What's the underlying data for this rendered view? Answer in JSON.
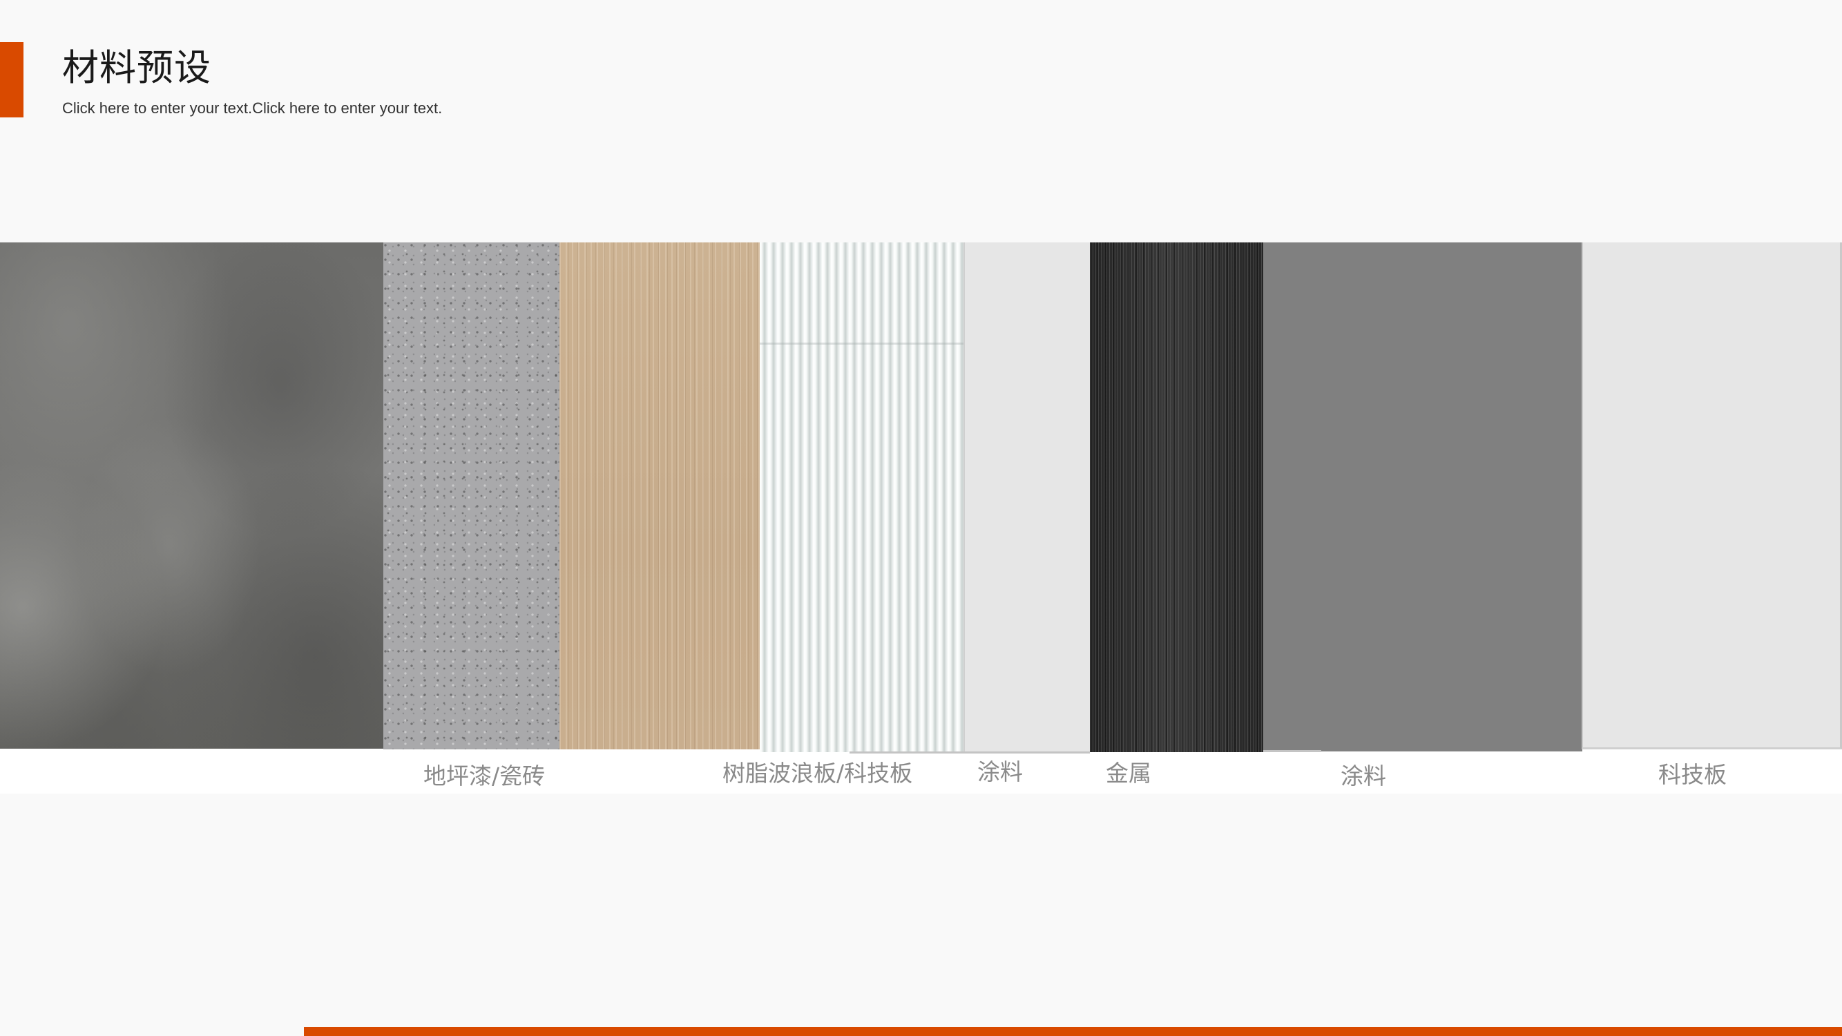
{
  "header": {
    "title": "材料预设",
    "subtitle": "Click here to enter your text.Click here to enter your text."
  },
  "materials": [
    {
      "label": "",
      "texture": "cement-gray"
    },
    {
      "label": "地坪漆/瓷砖",
      "texture": "terrazzo"
    },
    {
      "label": "",
      "texture": "light-wood"
    },
    {
      "label": "树脂波浪板/科技板",
      "texture": "corrugated-resin"
    },
    {
      "label": "涂料",
      "texture": "light-gray-paint"
    },
    {
      "label": "金属",
      "texture": "brushed-dark-metal"
    },
    {
      "label": "涂料",
      "texture": "mid-gray-paint"
    },
    {
      "label": "科技板",
      "texture": "light-gray-board"
    }
  ],
  "colors": {
    "accent": "#d94a00",
    "background": "#f9f9f9",
    "label_text": "#8a8a8a"
  }
}
